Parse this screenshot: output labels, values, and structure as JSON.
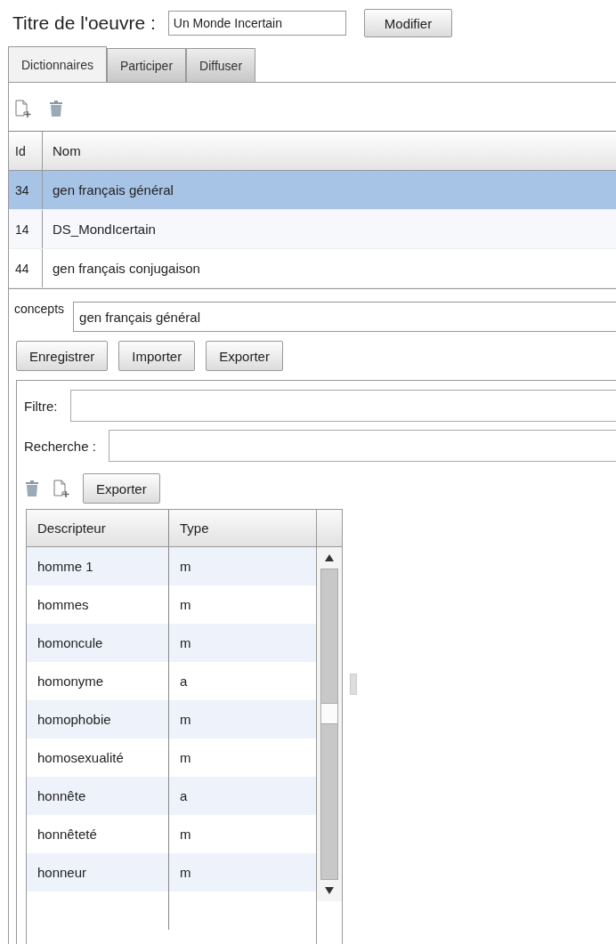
{
  "title_field": {
    "label": "Titre de l'oeuvre :",
    "value": "Un Monde Incertain",
    "button": "Modifier"
  },
  "tabs": [
    {
      "label": "Dictionnaires",
      "selected": true
    },
    {
      "label": "Participer",
      "selected": false
    },
    {
      "label": "Diffuser",
      "selected": false
    }
  ],
  "dictionaries": {
    "columns": [
      "Id",
      "Nom"
    ],
    "rows": [
      {
        "id": "34",
        "name": "gen français général",
        "selected": true
      },
      {
        "id": "14",
        "name": "DS_MondIcertain",
        "selected": false
      },
      {
        "id": "44",
        "name": "gen français conjugaison",
        "selected": false
      }
    ]
  },
  "concepts": {
    "label": "concepts",
    "value": "gen français général"
  },
  "buttons": [
    "Enregistrer",
    "Importer",
    "Exporter"
  ],
  "filter": {
    "label": "Filtre:"
  },
  "search": {
    "label": "Recherche :"
  },
  "export_button": "Exporter",
  "descriptors": {
    "columns": [
      "Descripteur",
      "Type"
    ],
    "rows": [
      {
        "descriptor": "homme 1",
        "type": "m"
      },
      {
        "descriptor": "hommes",
        "type": "m"
      },
      {
        "descriptor": "homoncule",
        "type": "m"
      },
      {
        "descriptor": "homonyme",
        "type": "a"
      },
      {
        "descriptor": "homophobie",
        "type": "m"
      },
      {
        "descriptor": "homosexualité",
        "type": "m"
      },
      {
        "descriptor": "honnête",
        "type": "a"
      },
      {
        "descriptor": "honnêteté",
        "type": "m"
      },
      {
        "descriptor": "honneur",
        "type": "m"
      }
    ]
  }
}
